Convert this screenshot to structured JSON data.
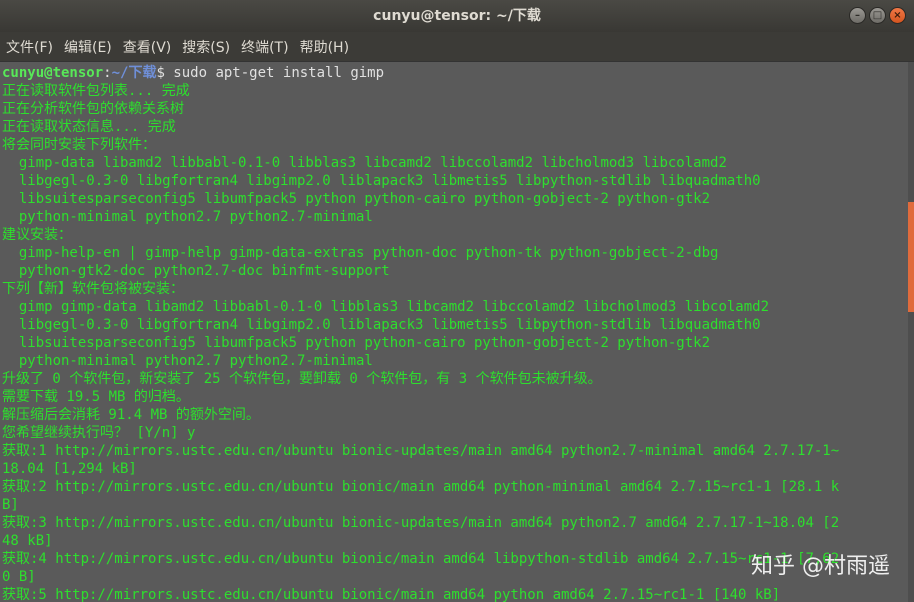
{
  "window": {
    "title": "cunyu@tensor: ~/下载"
  },
  "menu": [
    "文件(F)",
    "编辑(E)",
    "查看(V)",
    "搜索(S)",
    "终端(T)",
    "帮助(H)"
  ],
  "prompt": {
    "user": "cunyu@tensor",
    "sep": ":",
    "path": "~/下载",
    "command": "$ sudo apt-get install gimp"
  },
  "lines": [
    "正在读取软件包列表... 完成",
    "正在分析软件包的依赖关系树",
    "正在读取状态信息... 完成",
    "将会同时安装下列软件：",
    "  gimp-data libamd2 libbabl-0.1-0 libblas3 libcamd2 libccolamd2 libcholmod3 libcolamd2",
    "  libgegl-0.3-0 libgfortran4 libgimp2.0 liblapack3 libmetis5 libpython-stdlib libquadmath0",
    "  libsuitesparseconfig5 libumfpack5 python python-cairo python-gobject-2 python-gtk2",
    "  python-minimal python2.7 python2.7-minimal",
    "建议安装：",
    "  gimp-help-en | gimp-help gimp-data-extras python-doc python-tk python-gobject-2-dbg",
    "  python-gtk2-doc python2.7-doc binfmt-support",
    "下列【新】软件包将被安装：",
    "  gimp gimp-data libamd2 libbabl-0.1-0 libblas3 libcamd2 libccolamd2 libcholmod3 libcolamd2",
    "  libgegl-0.3-0 libgfortran4 libgimp2.0 liblapack3 libmetis5 libpython-stdlib libquadmath0",
    "  libsuitesparseconfig5 libumfpack5 python python-cairo python-gobject-2 python-gtk2",
    "  python-minimal python2.7 python2.7-minimal",
    "升级了 0 个软件包，新安装了 25 个软件包，要卸载 0 个软件包，有 3 个软件包未被升级。",
    "需要下载 19.5 MB 的归档。",
    "解压缩后会消耗 91.4 MB 的额外空间。",
    "您希望继续执行吗？ [Y/n] y",
    "获取:1 http://mirrors.ustc.edu.cn/ubuntu bionic-updates/main amd64 python2.7-minimal amd64 2.7.17-1~",
    "18.04 [1,294 kB]",
    "获取:2 http://mirrors.ustc.edu.cn/ubuntu bionic/main amd64 python-minimal amd64 2.7.15~rc1-1 [28.1 k",
    "B]",
    "获取:3 http://mirrors.ustc.edu.cn/ubuntu bionic-updates/main amd64 python2.7 amd64 2.7.17-1~18.04 [2",
    "48 kB]",
    "获取:4 http://mirrors.ustc.edu.cn/ubuntu bionic/main amd64 libpython-stdlib amd64 2.7.15~rc1-1 [7,62",
    "0 B]",
    "获取:5 http://mirrors.ustc.edu.cn/ubuntu bionic/main amd64 python amd64 2.7.15~rc1-1 [140 kB]"
  ],
  "watermark": "知乎 @村雨遥"
}
